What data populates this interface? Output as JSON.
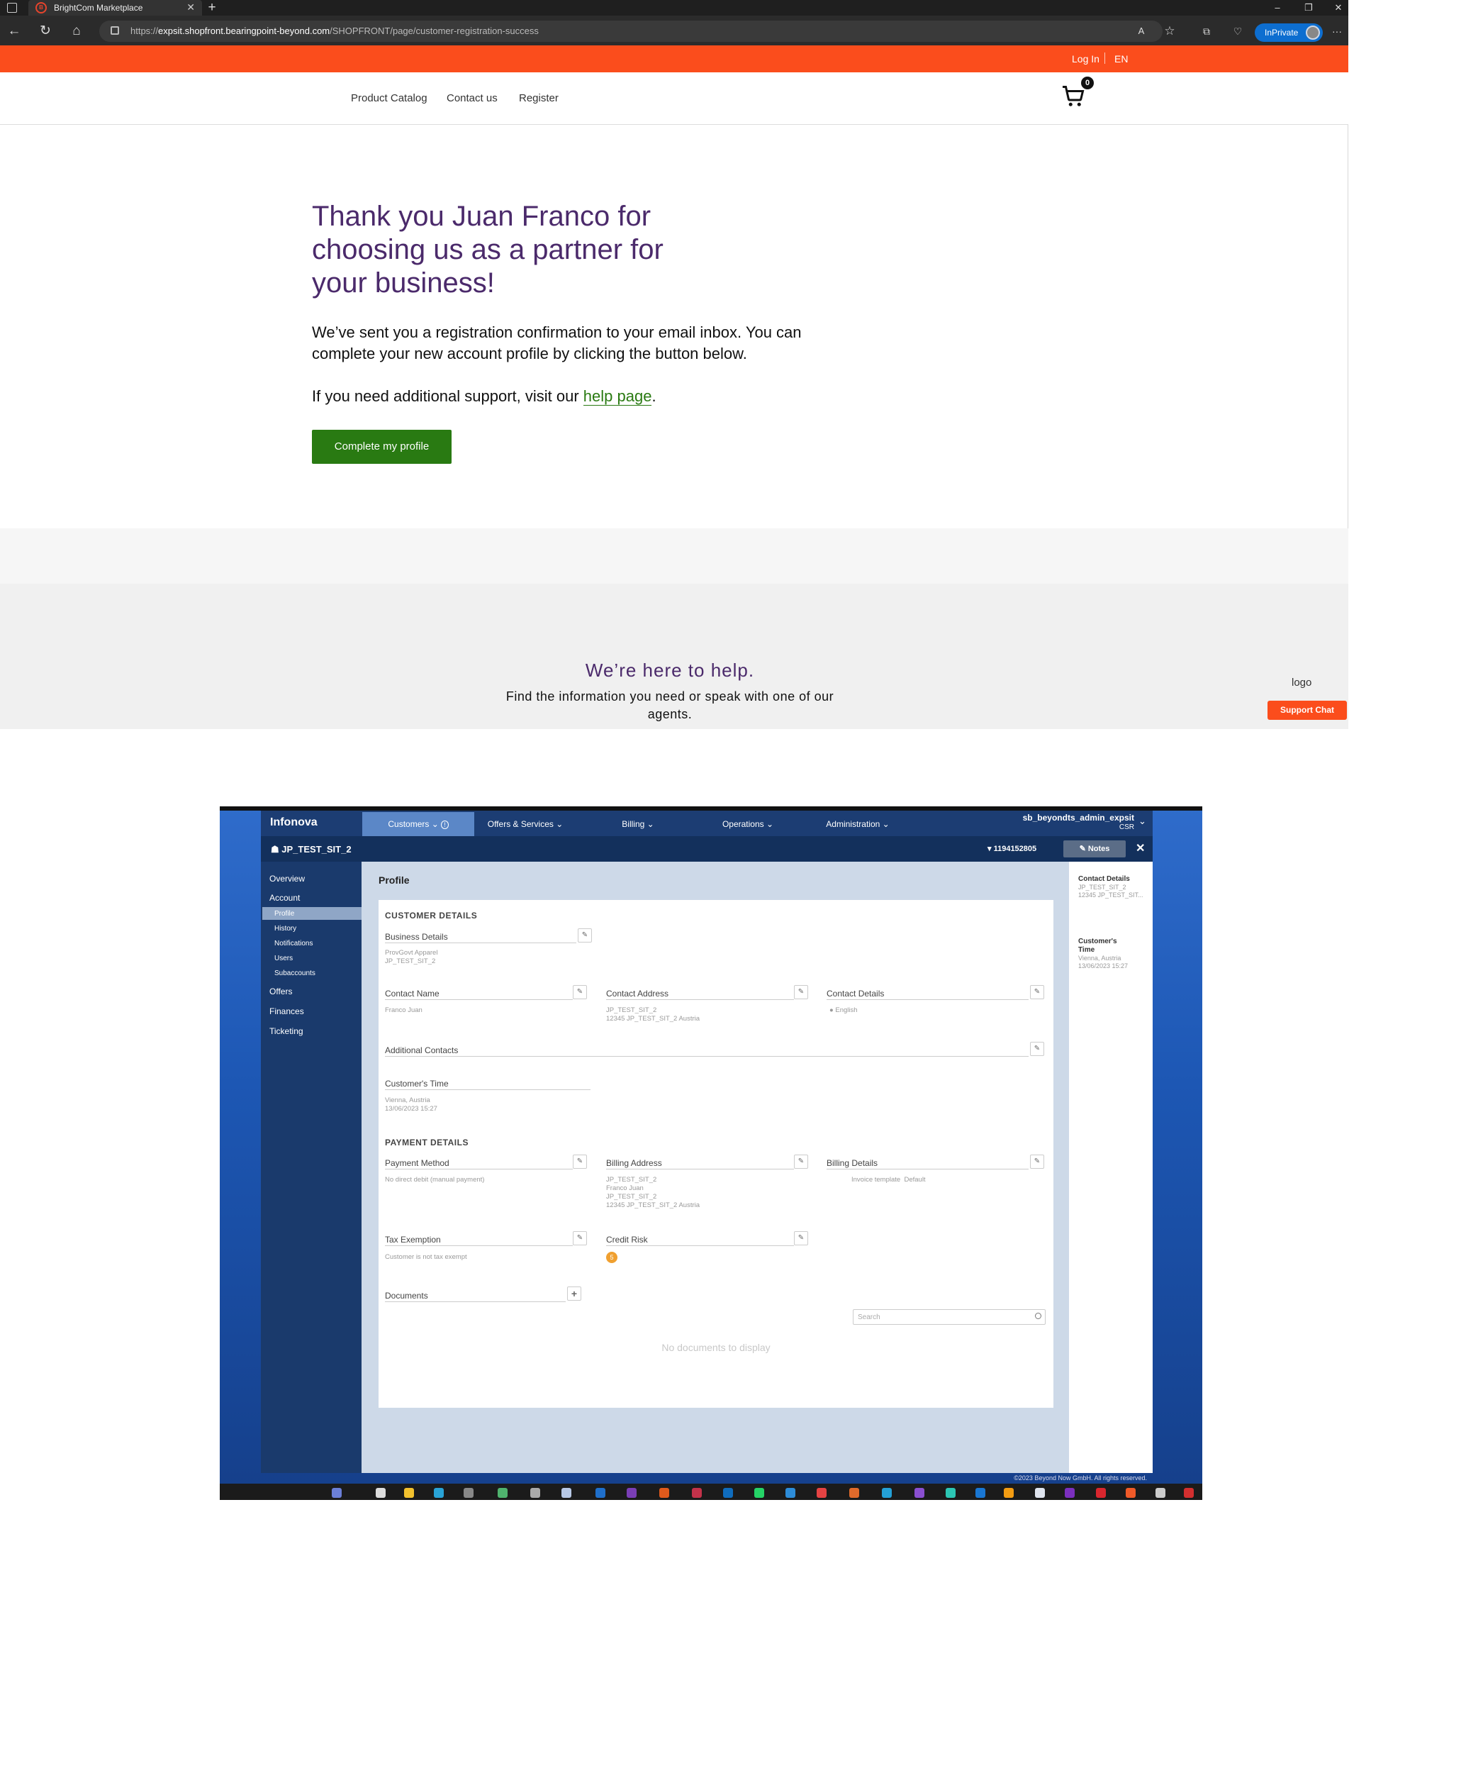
{
  "browser": {
    "tab_title": "BrightCom Marketplace",
    "favicon_text": "B",
    "new_tab": "+",
    "url_prefix": "https://",
    "url_host": "expsit.shopfront.bearingpoint-beyond.com",
    "url_path": "/SHOPFRONT/page/customer-registration-success",
    "inprivate": "InPrivate",
    "read_aloud": "A",
    "minimize": "–",
    "restore": "❐",
    "close": "✕",
    "more": "···"
  },
  "topbar": {
    "login": "Log In",
    "language": "EN"
  },
  "nav": {
    "items": [
      "Product Catalog",
      "Contact us",
      "Register"
    ],
    "cart_count": "0"
  },
  "main": {
    "heading": "Thank you Juan Franco for choosing us as a partner for your business!",
    "message": "We’ve sent you a registration confirmation to your email inbox. You can complete your new account profile by clicking the button below.",
    "support_prefix": "If you need additional support, visit our ",
    "support_link": "help page",
    "support_suffix": ".",
    "cta": "Complete my profile"
  },
  "help": {
    "title": "We’re here to help.",
    "subtitle": "Find the information you need or speak with one of our agents.",
    "logo_alt": "logo",
    "support_chat": "Support Chat"
  },
  "infonova": {
    "brand": "Infonova",
    "menu": [
      "Customers",
      "Offers & Services",
      "Billing",
      "Operations",
      "Administration"
    ],
    "user": "sb_beyondts_admin_expsit",
    "role": "CSR",
    "customer": "JP_TEST_SIT_2",
    "account": "1194152805",
    "notes": "Notes",
    "sidebar": {
      "overview": "Overview",
      "account": "Account",
      "profile": "Profile",
      "history": "History",
      "notifications": "Notifications",
      "users": "Users",
      "subaccounts": "Subaccounts",
      "offers": "Offers",
      "finances": "Finances",
      "ticketing": "Ticketing"
    },
    "page_title": "Profile",
    "customer_details": "CUSTOMER DETAILS",
    "business_details": {
      "label": "Business Details",
      "line1": "ProvGovt Apparel",
      "line2": "JP_TEST_SIT_2"
    },
    "contact_name": {
      "label": "Contact Name",
      "value": "Franco Juan"
    },
    "contact_address": {
      "label": "Contact Address",
      "line1": "JP_TEST_SIT_2",
      "line2": "12345 JP_TEST_SIT_2 Austria"
    },
    "contact_details": {
      "label": "Contact Details",
      "value": "English"
    },
    "additional_contacts": "Additional Contacts",
    "customers_time": {
      "label": "Customer's Time",
      "line1": "Vienna, Austria",
      "line2": "13/06/2023 15:27"
    },
    "payment_details": "PAYMENT DETAILS",
    "payment_method": {
      "label": "Payment Method",
      "value": "No direct debit (manual payment)"
    },
    "billing_address": {
      "label": "Billing Address",
      "line1": "JP_TEST_SIT_2",
      "line2": "Franco Juan",
      "line3": "JP_TEST_SIT_2",
      "line4": "12345 JP_TEST_SIT_2 Austria"
    },
    "billing_details": {
      "label": "Billing Details",
      "key": "Invoice template",
      "value": "Default"
    },
    "tax_exemption": {
      "label": "Tax Exemption",
      "value": "Customer is not tax exempt"
    },
    "credit_risk": {
      "label": "Credit Risk",
      "value": "5"
    },
    "documents": {
      "label": "Documents",
      "search_placeholder": "Search",
      "empty": "No documents to display"
    },
    "right_panel": {
      "contact_title": "Contact Details",
      "contact_line1": "JP_TEST_SIT_2",
      "contact_line2": "12345 JP_TEST_SIT...",
      "time_title": "Customer's Time",
      "time_line1": "Vienna, Austria",
      "time_line2": "13/06/2023 15:27"
    },
    "footer": "©2023 Beyond Now GmbH. All rights reserved."
  }
}
